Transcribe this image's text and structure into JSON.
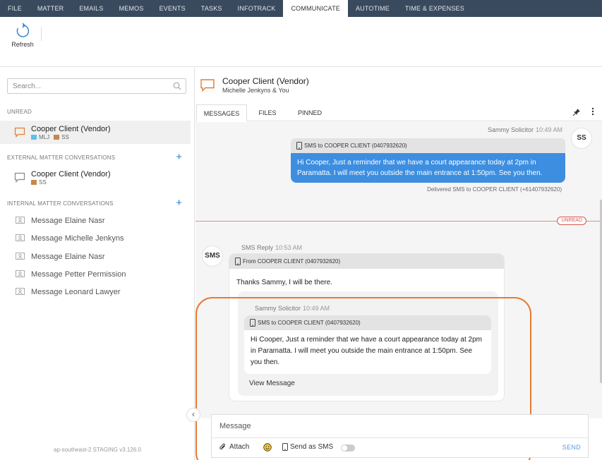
{
  "menu": {
    "tabs": [
      "FILE",
      "MATTER",
      "EMAILS",
      "MEMOS",
      "EVENTS",
      "TASKS",
      "INFOTRACK",
      "COMMUNICATE",
      "AUTOTIME",
      "TIME & EXPENSES"
    ],
    "active": "COMMUNICATE"
  },
  "ribbon": {
    "refresh_label": "Refresh",
    "refresh_icon": "refresh-icon"
  },
  "sidebar": {
    "search_placeholder": "Search...",
    "unread_heading": "UNREAD",
    "unread": [
      {
        "title": "Cooper Client (Vendor)",
        "tags": [
          {
            "text": "MLJ",
            "color": "#5bc0eb"
          },
          {
            "text": "SS",
            "color": "#c8864a"
          }
        ]
      }
    ],
    "external_heading": "EXTERNAL MATTER CONVERSATIONS",
    "external": [
      {
        "title": "Cooper Client (Vendor)",
        "tags": [
          {
            "text": "SS",
            "color": "#c8864a"
          }
        ]
      }
    ],
    "internal_heading": "INTERNAL MATTER CONVERSATIONS",
    "add_label": "+",
    "internal": [
      "Message Elaine Nasr",
      "Message Michelle Jenkyns",
      "Message Elaine Nasr",
      "Message Petter Permission",
      "Message Leonard Lawyer"
    ],
    "version": "ap-southeast-2 STAGING v3.126.0"
  },
  "conversation": {
    "title": "Cooper Client (Vendor)",
    "participants": "Michelle Jenkyns & You",
    "tabs": [
      "MESSAGES",
      "FILES",
      "PINNED"
    ],
    "active_tab": "MESSAGES"
  },
  "outgoing": {
    "sender": "Sammy Solicitor",
    "time": "10:49 AM",
    "avatar": "SS",
    "header": "SMS to COOPER CLIENT (0407932620)",
    "body": "Hi Cooper, Just a reminder that we have a court appearance today at 2pm in Paramatta. I will meet you outside the main entrance at 1:50pm. See you then.",
    "status": "Delivered SMS to COOPER CLIENT (+61407932620)"
  },
  "unread_badge": "UNREAD",
  "incoming": {
    "sender": "SMS Reply",
    "time": "10:53 AM",
    "avatar": "SMS",
    "header": "From COOPER CLIENT (0407932620)",
    "body": "Thanks Sammy, I will be there.",
    "quoted": {
      "sender": "Sammy Solicitor",
      "time": "10:49 AM",
      "header": "SMS to COOPER CLIENT (0407932620)",
      "body": "Hi Cooper, Just a reminder that we have a court appearance today at 2pm in Paramatta. I will meet you outside the main entrance at 1:50pm. See you then.",
      "view_label": "View Message"
    }
  },
  "composer": {
    "placeholder": "Message",
    "attach_label": "Attach",
    "sms_label": "Send as SMS",
    "send_label": "SEND"
  },
  "colors": {
    "accent": "#3d8ee0",
    "highlight": "#e57b34",
    "unread": "#d9534f",
    "menubar": "#3a4a5e"
  }
}
